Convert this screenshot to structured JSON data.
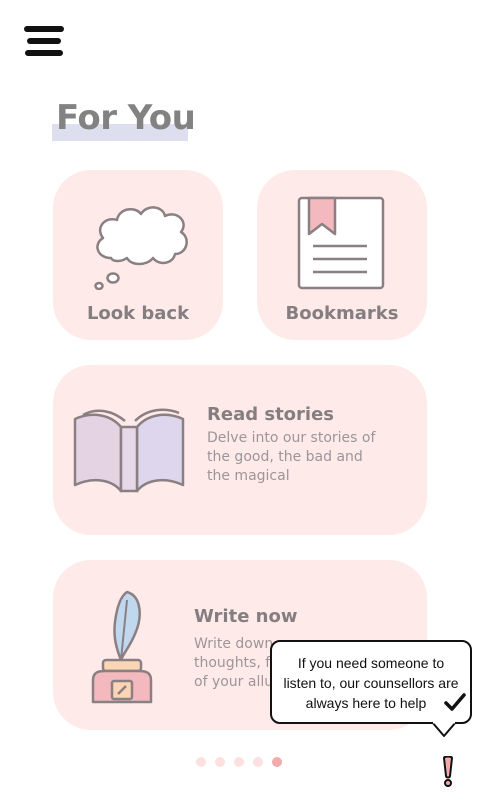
{
  "header": {
    "title": "For You",
    "menu_icon": "hamburger-menu-icon"
  },
  "cards": {
    "look_back": {
      "label": "Look back",
      "icon": "thought-cloud-icon"
    },
    "bookmarks": {
      "label": "Bookmarks",
      "icon": "bookmark-document-icon"
    },
    "read_stories": {
      "title": "Read stories",
      "description_lines": [
        "Delve into our stories of",
        "the good, the bad and",
        "the magical"
      ],
      "icon": "open-book-icon"
    },
    "write_now": {
      "title": "Write now",
      "description_lines": [
        "Write down your",
        "thoughts, feelings",
        "of your allure"
      ],
      "icon": "quill-inkpot-icon"
    }
  },
  "pagination": {
    "count": 5,
    "active_index": 4
  },
  "help_bubble": {
    "lines": [
      "If you need someone to",
      "listen to, our counsellors are",
      "always here to help"
    ],
    "icons": [
      "checkmark-icon",
      "exclamation-icon"
    ]
  },
  "colors": {
    "card_bg": "#ffeaea",
    "title_highlight": "#dedfee",
    "dot_inactive": "#fde0e0",
    "dot_active": "#f2aaaa",
    "accent_pink": "#f4b9be",
    "icon_stroke": "#8a7f82"
  }
}
